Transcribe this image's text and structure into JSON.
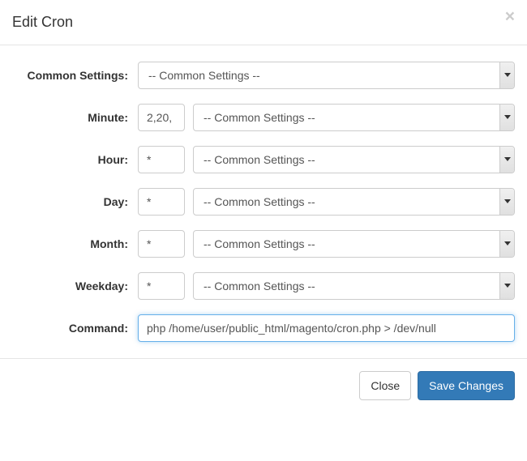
{
  "modal": {
    "title": "Edit Cron",
    "close_x": "×"
  },
  "labels": {
    "common_settings": "Common Settings:",
    "minute": "Minute:",
    "hour": "Hour:",
    "day": "Day:",
    "month": "Month:",
    "weekday": "Weekday:",
    "command": "Command:"
  },
  "values": {
    "common_settings_select": "-- Common Settings --",
    "minute_input": "2,20,",
    "minute_select": "-- Common Settings --",
    "hour_input": "*",
    "hour_select": "-- Common Settings --",
    "day_input": "*",
    "day_select": "-- Common Settings --",
    "month_input": "*",
    "month_select": "-- Common Settings --",
    "weekday_input": "*",
    "weekday_select": "-- Common Settings --",
    "command_input": "php /home/user/public_html/magento/cron.php > /dev/null"
  },
  "footer": {
    "close": "Close",
    "save": "Save Changes"
  }
}
